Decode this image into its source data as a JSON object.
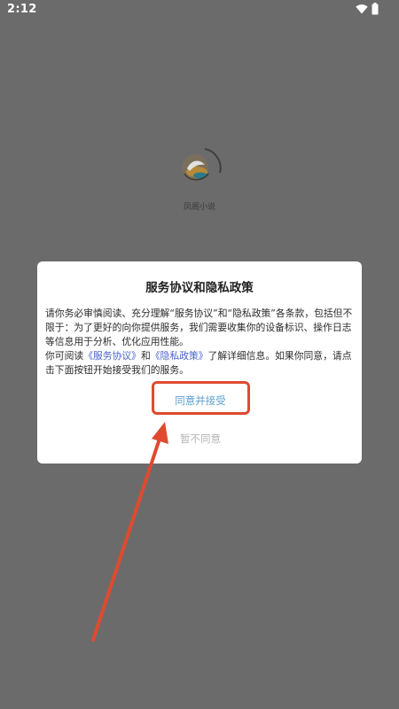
{
  "status_bar": {
    "time": "2:12",
    "icons": [
      "wifi-icon",
      "battery-icon"
    ]
  },
  "splash": {
    "app_name": "凤阁小说",
    "logo_icon": "app-logo-icon"
  },
  "dialog": {
    "title": "服务协议和隐私政策",
    "body_paragraph_1": "请你务必审慎阅读、充分理解“服务协议”和“隐私政策”各条款，包括但不限于：为了更好的向你提供服务，我们需要收集你的设备标识、操作日志等信息用于分析、优化应用性能。",
    "body_p2_prefix": "你可阅读",
    "service_agreement_link": "《服务协议》",
    "body_p2_and": "和",
    "privacy_policy_link": "《隐私政策》",
    "body_p2_suffix": "了解详细信息。如果你同意，请点击下面按钮开始接受我们的服务。",
    "accept_label": "同意并接受",
    "decline_label": "暂不同意"
  },
  "annotation": {
    "color": "#e04a2f"
  },
  "colors": {
    "overlay": "#6b6b6b",
    "link": "#4a63c8",
    "accept_text": "#5a9fd0",
    "decline_text": "#b5b5b5"
  }
}
